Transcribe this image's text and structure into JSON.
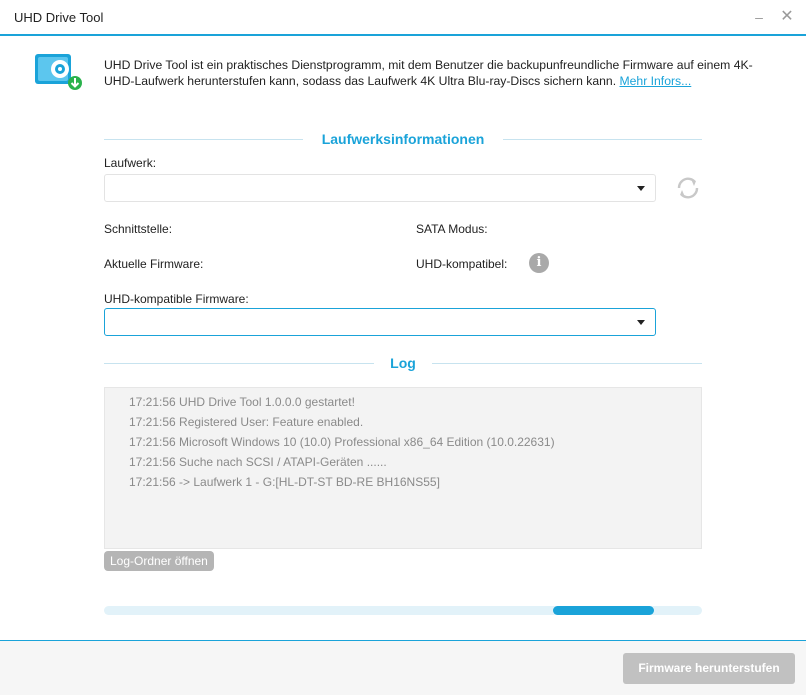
{
  "window": {
    "title": "UHD Drive Tool",
    "minimize_glyph": "–",
    "close_glyph": "✕"
  },
  "intro": {
    "text": "UHD Drive Tool ist ein praktisches Dienstprogramm, mit dem Benutzer die backupunfreundliche Firmware auf einem 4K-UHD-Laufwerk herunterstufen kann, sodass das Laufwerk 4K Ultra Blu-ray-Discs sichern kann. ",
    "link": "Mehr Infors..."
  },
  "drive_info": {
    "title": "Laufwerksinformationen",
    "drive_label": "Laufwerk:",
    "drive_value": "",
    "interface_label": "Schnittstelle:",
    "sata_label": "SATA Modus:",
    "firmware_label": "Aktuelle Firmware:",
    "uhd_compat_label": "UHD-kompatibel:",
    "uhd_firmware_label": "UHD-kompatible Firmware:",
    "uhd_firmware_value": ""
  },
  "log": {
    "title": "Log",
    "lines": [
      "17:21:56 UHD Drive Tool 1.0.0.0 gestartet!",
      "17:21:56 Registered User: Feature enabled.",
      "17:21:56 Microsoft Windows 10 (10.0) Professional x86_64 Edition (10.0.22631)",
      "17:21:56 Suche nach SCSI / ATAPI-Geräten ......",
      "17:21:56 -> Laufwerk 1 - G:[HL-DT-ST BD-RE BH16NS55]"
    ],
    "open_folder_label": "Log-Ordner öffnen"
  },
  "progress": {
    "indicator_start": 0.75,
    "indicator_end": 0.92
  },
  "footer": {
    "primary_label": "Firmware herunterstufen"
  },
  "colors": {
    "accent": "#1aa3d9",
    "disabled": "#c1c1c1",
    "log_text": "#8a8a8a"
  },
  "icons": {
    "app": "disc-drive-download-icon",
    "refresh": "refresh-icon",
    "info": "info-icon",
    "dropdown": "chevron-down-icon"
  }
}
